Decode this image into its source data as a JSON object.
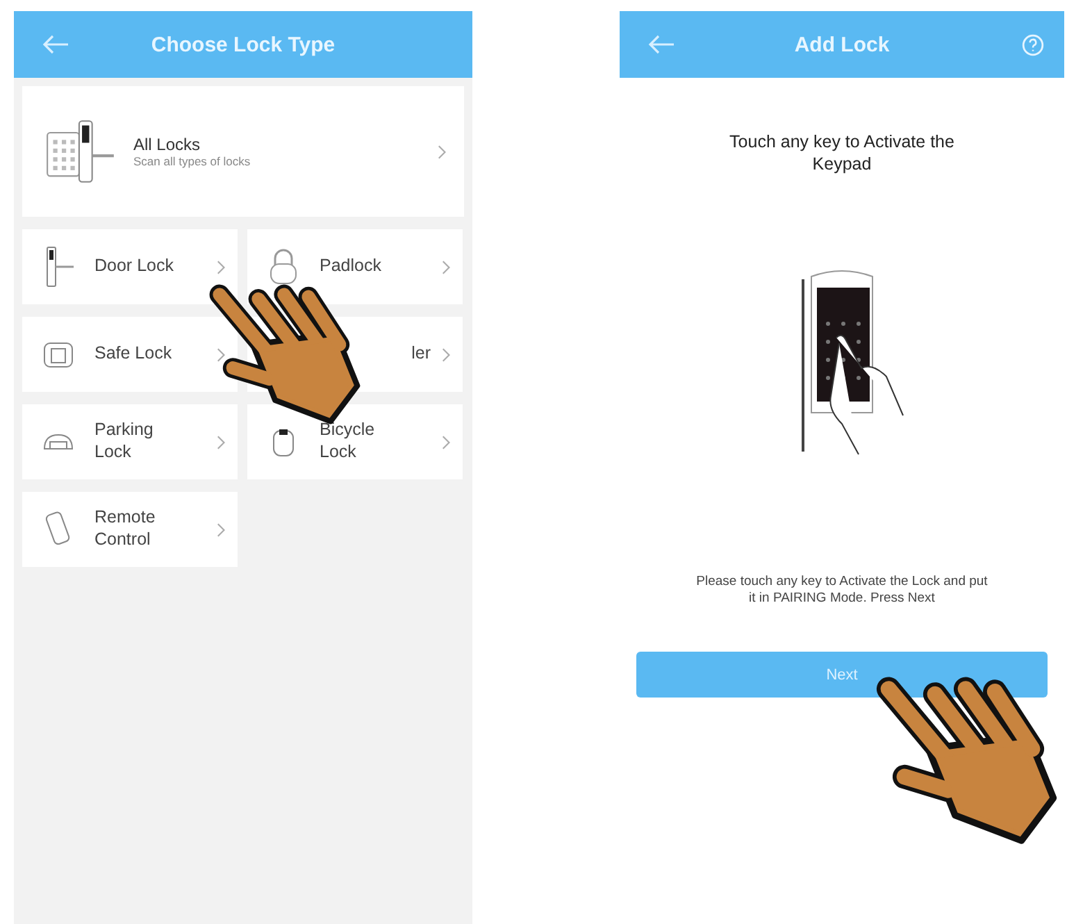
{
  "left_screen": {
    "title": "Choose Lock Type",
    "featured": {
      "title": "All Locks",
      "subtitle": "Scan all types of locks"
    },
    "lock_types": [
      {
        "label": "Door Lock"
      },
      {
        "label": "Padlock"
      },
      {
        "label": "Safe Lock"
      },
      {
        "label": "ler"
      },
      {
        "label": "Parking\nLock"
      },
      {
        "label": "Bicycle\nLock"
      },
      {
        "label": "Remote\nControl"
      }
    ]
  },
  "right_screen": {
    "title": "Add Lock",
    "heading": "Touch any key to Activate the Keypad",
    "instruction": "Please touch any key to Activate the Lock and put it in PAIRING Mode. Press Next",
    "button": "Next"
  }
}
